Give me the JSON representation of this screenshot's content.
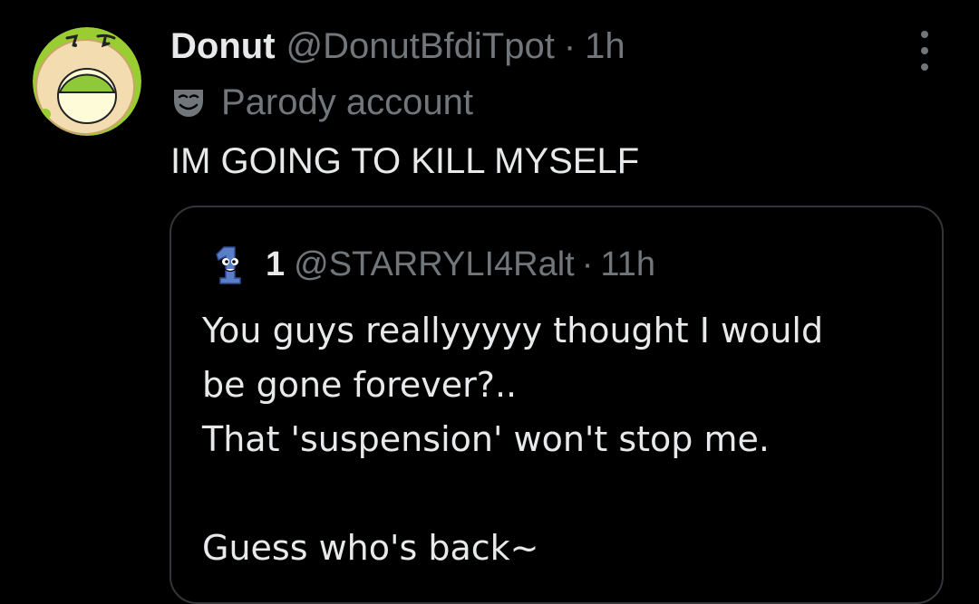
{
  "tweet": {
    "display_name": "Donut",
    "handle": "@DonutBfdiTpot",
    "separator": "·",
    "time": "1h",
    "label": "Parody account",
    "text": "IM GOING TO KILL MYSELF",
    "avatar_icon": "donut-character-avatar",
    "label_icon": "parody-mask-icon",
    "more_icon": "more-options-icon"
  },
  "quoted_tweet": {
    "display_name": "1",
    "handle": "@STARRYLI4Ralt",
    "separator": "·",
    "time": "11h",
    "avatar_icon": "one-character-avatar",
    "lines": [
      "You guys reallyyyyy thought I would",
      "be gone forever?..",
      "That 'suspension' won't stop me.",
      "",
      "Guess who's back~"
    ]
  },
  "colors": {
    "background": "#000000",
    "primary_text": "#e7e9ea",
    "secondary_text": "#71767b",
    "card_border": "#333639"
  }
}
